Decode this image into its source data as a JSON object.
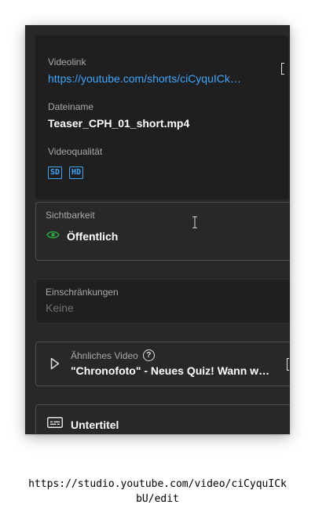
{
  "video_info": {
    "videolink_label": "Videolink",
    "videolink_value": "https://youtube.com/shorts/ciCyquICk…",
    "filename_label": "Dateiname",
    "filename_value": "Teaser_CPH_01_short.mp4",
    "quality_label": "Videoqualität",
    "quality_badges": [
      "SD",
      "HD"
    ]
  },
  "visibility": {
    "label": "Sichtbarkeit",
    "value": "Öffentlich",
    "icon": "eye-icon"
  },
  "restrictions": {
    "label": "Einschränkungen",
    "value": "Keine"
  },
  "related_video": {
    "label": "Ähnliches Video",
    "help": "?",
    "title": "\"Chronofoto\" - Neues Quiz! Wann wu…",
    "icon": "play-icon"
  },
  "subtitles": {
    "label": "Untertitel",
    "icon": "subtitles-icon"
  },
  "caption": {
    "url_line1": "https://studio.youtube.com/video/ciCyquICk",
    "url_line2": "bU/edit"
  },
  "colors": {
    "panel": "#282828",
    "card": "#1f1f1f",
    "link": "#3ea6ff",
    "eye": "#2ba640"
  }
}
